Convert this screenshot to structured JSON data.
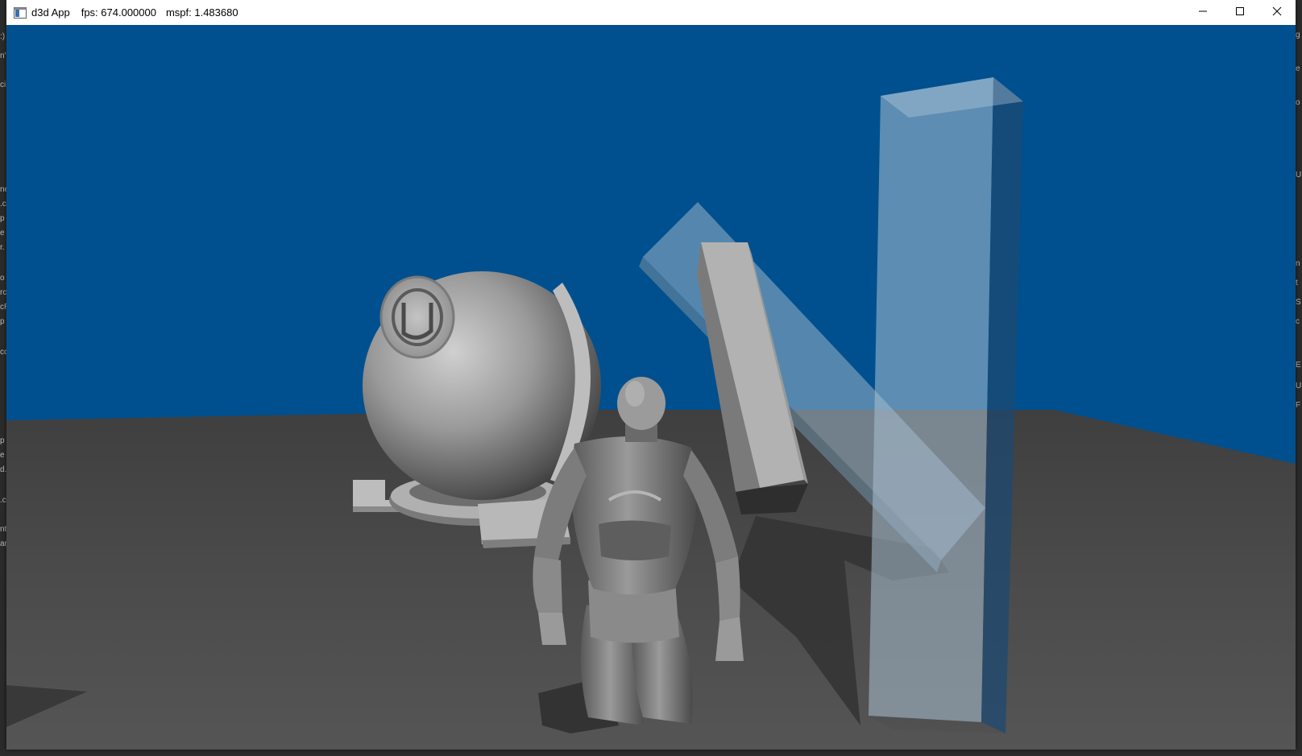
{
  "window": {
    "title": "d3d App",
    "fps": "fps: 674.000000",
    "mspf": "mspf: 1.483680",
    "icon": "app-icon",
    "controls": [
      "minimize-icon",
      "maximize-icon",
      "close-icon"
    ]
  },
  "scene": {
    "sky_color": "#00508f",
    "floor_color": "#4a4a4a",
    "objects": [
      "sphere",
      "sphere-pedestal",
      "character",
      "tilted-box",
      "transparent-slab",
      "tall-transparent-pillar"
    ]
  }
}
